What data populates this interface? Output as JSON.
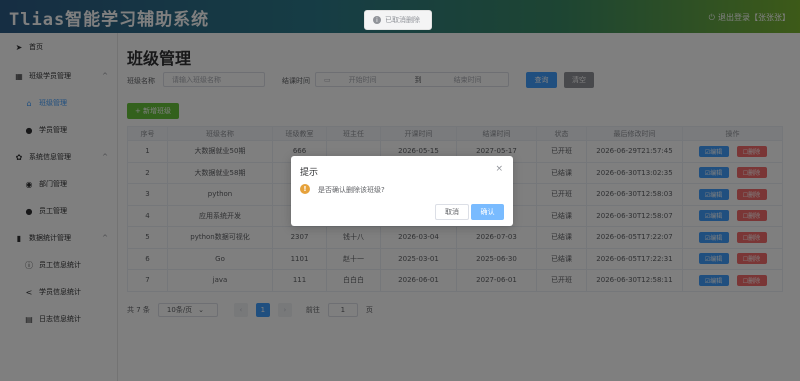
{
  "header": {
    "app_title": "Tlias智能学习辅助系统",
    "logout_label": "退出登录【张张张】",
    "logout_icon": "power-icon"
  },
  "toast": {
    "text": "已取消删除",
    "icon": "info-icon"
  },
  "sidebar": {
    "items": [
      {
        "label": "首页",
        "icon": "send-icon",
        "type": "item"
      },
      {
        "label": "班级学员管理",
        "icon": "grid-icon",
        "type": "group"
      },
      {
        "label": "班级管理",
        "icon": "home-icon",
        "type": "sub",
        "active": true
      },
      {
        "label": "学员管理",
        "icon": "user-icon",
        "type": "sub"
      },
      {
        "label": "系统信息管理",
        "icon": "gear-icon",
        "type": "group"
      },
      {
        "label": "部门管理",
        "icon": "circle-icon",
        "type": "sub"
      },
      {
        "label": "员工管理",
        "icon": "user-icon",
        "type": "sub"
      },
      {
        "label": "数据统计管理",
        "icon": "bar-chart-icon",
        "type": "group"
      },
      {
        "label": "员工信息统计",
        "icon": "info-icon",
        "type": "sub"
      },
      {
        "label": "学员信息统计",
        "icon": "share-icon",
        "type": "sub"
      },
      {
        "label": "日志信息统计",
        "icon": "document-icon",
        "type": "sub"
      }
    ]
  },
  "main": {
    "title": "班级管理",
    "search": {
      "name_label": "班级名称",
      "name_placeholder": "请输入班级名称",
      "end_time_label": "结课时间",
      "start_placeholder": "开始时间",
      "range_sep": "到",
      "end_placeholder": "结束时间",
      "query_label": "查询",
      "clear_label": "清空"
    },
    "add_label": "+ 新增班级",
    "table": {
      "columns": [
        "序号",
        "班级名称",
        "班级教室",
        "班主任",
        "开课时间",
        "结课时间",
        "状态",
        "最后修改时间",
        "操作"
      ],
      "edit_label": "☑编辑",
      "delete_label": "☐删除",
      "rows": [
        [
          "1",
          "大数据就业50期",
          "666",
          "",
          "2026-05-15",
          "2027-05-17",
          "已开班",
          "2026-06-29T21:57:45"
        ],
        [
          "2",
          "大数据就业58期",
          "209",
          "",
          "",
          "",
          "已结课",
          "2026-06-30T13:02:35"
        ],
        [
          "3",
          "python",
          "121",
          "",
          "",
          "",
          "已开班",
          "2026-06-30T12:58:03"
        ],
        [
          "4",
          "应用系统开发",
          "A.A",
          "",
          "",
          "",
          "已结课",
          "2026-06-30T12:58:07"
        ],
        [
          "5",
          "python数据可视化",
          "2307",
          "钱十八",
          "2026-03-04",
          "2026-07-03",
          "已结课",
          "2026-06-05T17:22:07"
        ],
        [
          "6",
          "Go",
          "1101",
          "赵十一",
          "2025-03-01",
          "2025-06-30",
          "已结课",
          "2026-06-05T17:22:31"
        ],
        [
          "7",
          "java",
          "111",
          "白白白",
          "2026-06-01",
          "2027-06-01",
          "已开班",
          "2026-06-30T12:58:11"
        ]
      ]
    },
    "pager": {
      "total_label": "共 7 条",
      "page_size": "10条/页",
      "prev": "‹",
      "current_page": "1",
      "next": "›",
      "goto_label": "前往",
      "goto_value": "1",
      "page_unit": "页"
    }
  },
  "dialog": {
    "title": "提示",
    "close": "×",
    "message": "是否确认删除该班级?",
    "cancel_label": "取消",
    "ok_label": "确认",
    "warn_icon": "warning-icon"
  }
}
